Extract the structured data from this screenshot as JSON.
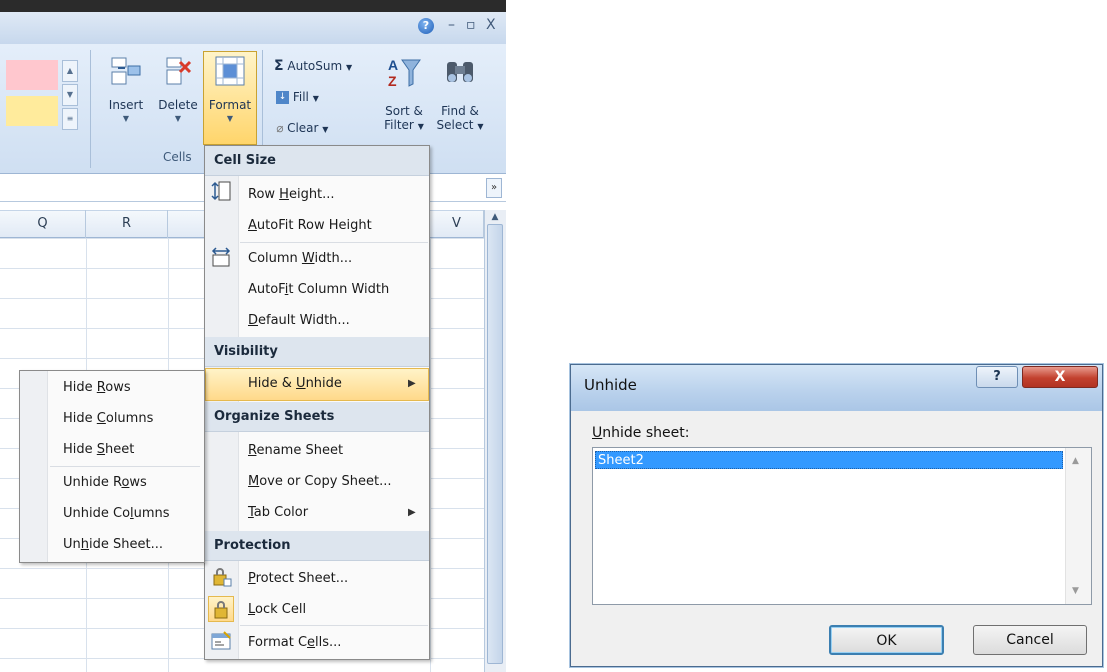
{
  "excel": {
    "window_controls": {
      "help": "?",
      "minimize": "–",
      "restore": "▫",
      "close": "X"
    },
    "ribbon": {
      "cells_group": {
        "label": "Cells",
        "insert": "Insert",
        "delete": "Delete",
        "format": "Format"
      },
      "editing_group": {
        "autosum": "AutoSum",
        "fill": "Fill",
        "clear": "Clear",
        "sort_filter_line1": "Sort &",
        "sort_filter_line2": "Filter",
        "find_select_line1": "Find &",
        "find_select_line2": "Select"
      }
    },
    "columns": [
      "Q",
      "R",
      "V"
    ]
  },
  "format_menu": {
    "sections": {
      "cell_size": "Cell Size",
      "visibility": "Visibility",
      "organize": "Organize Sheets",
      "protection": "Protection"
    },
    "items": {
      "row_height": {
        "pre": "Row ",
        "u": "H",
        "post": "eight..."
      },
      "autofit_row_height": {
        "pre": "",
        "u": "A",
        "post": "utoFit Row Height"
      },
      "column_width": {
        "pre": "Column ",
        "u": "W",
        "post": "idth..."
      },
      "autofit_column_width": {
        "pre": "AutoF",
        "u": "i",
        "post": "t Column Width"
      },
      "default_width": {
        "pre": "",
        "u": "D",
        "post": "efault Width..."
      },
      "hide_unhide": {
        "pre": "Hide & ",
        "u": "U",
        "post": "nhide"
      },
      "rename_sheet": {
        "pre": "",
        "u": "R",
        "post": "ename Sheet"
      },
      "move_copy": {
        "pre": "",
        "u": "M",
        "post": "ove or Copy Sheet..."
      },
      "tab_color": {
        "pre": "",
        "u": "T",
        "post": "ab Color"
      },
      "protect_sheet": {
        "pre": "",
        "u": "P",
        "post": "rotect Sheet..."
      },
      "lock_cell": {
        "pre": "",
        "u": "L",
        "post": "ock Cell"
      },
      "format_cells": {
        "pre": "Format C",
        "u": "e",
        "post": "lls..."
      }
    }
  },
  "submenu": {
    "hide_rows": {
      "pre": "Hide ",
      "u": "R",
      "post": "ows"
    },
    "hide_columns": {
      "pre": "Hide ",
      "u": "C",
      "post": "olumns"
    },
    "hide_sheet": {
      "pre": "Hide ",
      "u": "S",
      "post": "heet"
    },
    "unhide_rows": {
      "pre": "Unhide R",
      "u": "o",
      "post": "ws"
    },
    "unhide_columns": {
      "pre": "Unhide Co",
      "u": "l",
      "post": "umns"
    },
    "unhide_sheet": {
      "pre": "Un",
      "u": "h",
      "post": "ide Sheet..."
    }
  },
  "dialog": {
    "title": "Unhide",
    "help_button": "?",
    "close_button": "X",
    "label": {
      "pre": "",
      "u": "U",
      "post": "nhide sheet:"
    },
    "sheets": [
      "Sheet2"
    ],
    "ok": "OK",
    "cancel": "Cancel"
  }
}
